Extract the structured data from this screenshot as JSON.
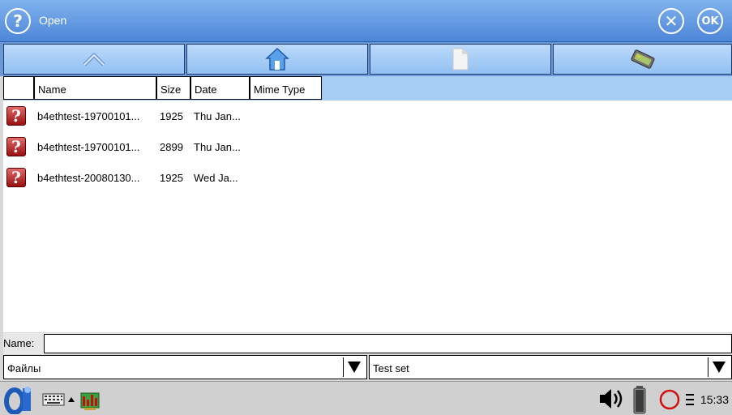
{
  "window": {
    "title": "Open"
  },
  "toolbar": {
    "buttons": [
      {
        "icon": "up-arrow-icon"
      },
      {
        "icon": "home-icon"
      },
      {
        "icon": "document-icon"
      },
      {
        "icon": "keyboard-card-icon"
      }
    ]
  },
  "columns": [
    "Name",
    "Size",
    "Date",
    "Mime Type"
  ],
  "files": [
    {
      "name": "b4ethtest-19700101...",
      "size": "1925",
      "date": "Thu Jan..."
    },
    {
      "name": "b4ethtest-19700101...",
      "size": "2899",
      "date": "Thu Jan..."
    },
    {
      "name": "b4ethtest-20080130...",
      "size": "1925",
      "date": "Wed Ja..."
    }
  ],
  "name_field": {
    "label": "Name:",
    "value": ""
  },
  "location_select": {
    "value": "Файлы"
  },
  "filter_select": {
    "value": "Test set"
  },
  "taskbar": {
    "clock": "15:33"
  },
  "colors": {
    "titlebar": "#5a8ee0",
    "toolbar": "#6d98d6",
    "header": "#a8cdf4"
  }
}
